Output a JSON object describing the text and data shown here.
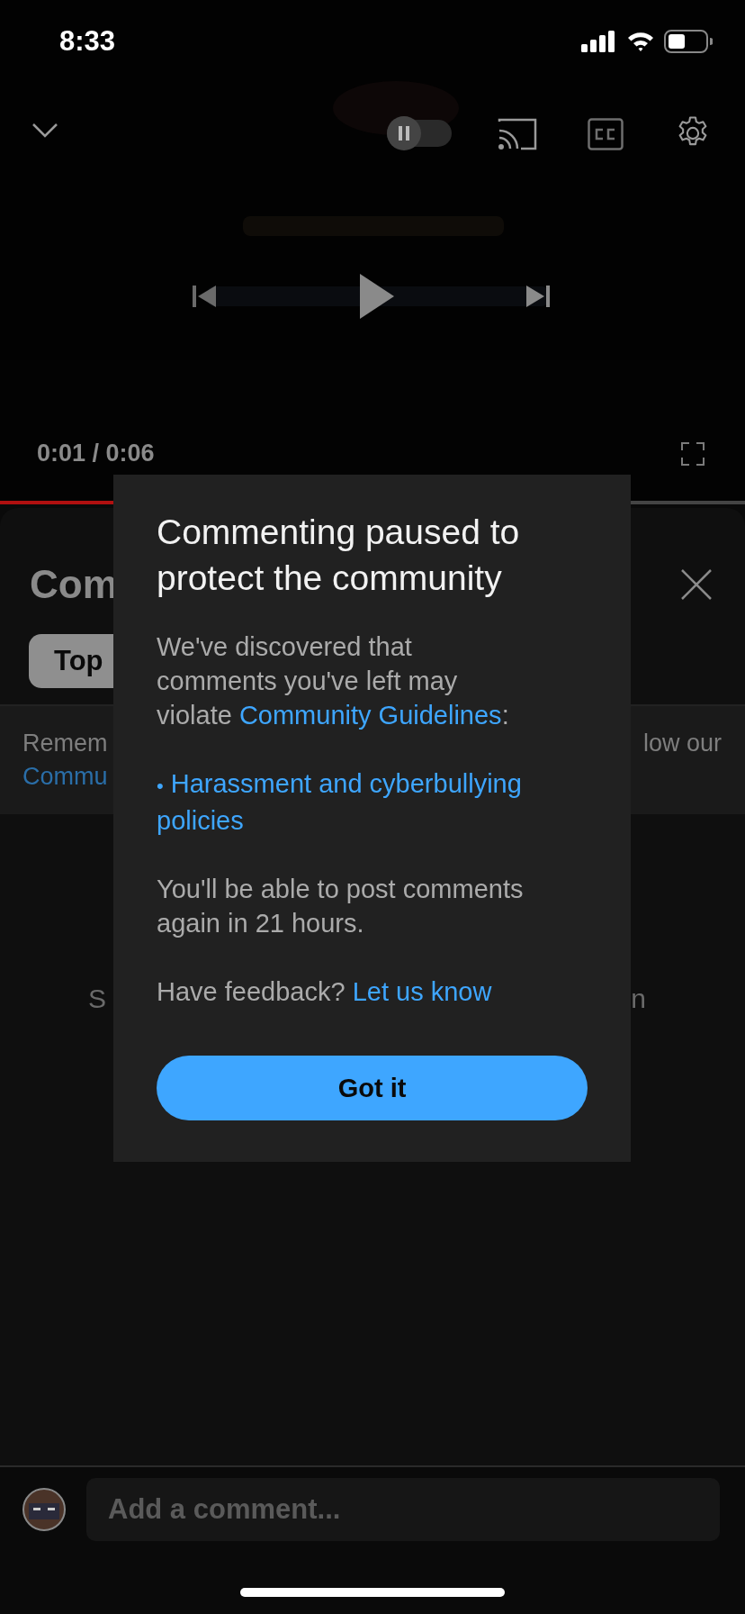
{
  "status_bar": {
    "time": "8:33"
  },
  "player": {
    "autoplay_on": false,
    "time": "0:01 / 0:06",
    "level": 0.17
  },
  "comments_panel": {
    "title": "Com",
    "tabs": [
      {
        "label": "Top",
        "selected": true
      }
    ],
    "notice": {
      "text_left": "Remem",
      "link": "Commu",
      "text_right": "low our"
    },
    "empty_left": "S",
    "empty_right": "n"
  },
  "dialog": {
    "title": "Commenting paused to protect the community",
    "intro": {
      "text": "We've discovered that comments you've left may violate ",
      "link": "Community Guidelines",
      "after": ":"
    },
    "bullet": "•",
    "policy_link": "Harassment and cyberbullying policies",
    "notice": "You'll be able to post comments again in 21 hours.",
    "feedback": {
      "text": "Have feedback?",
      "link": "Let us know"
    },
    "button": "Got it"
  },
  "comment_box": {
    "placeholder": "Add a comment..."
  }
}
